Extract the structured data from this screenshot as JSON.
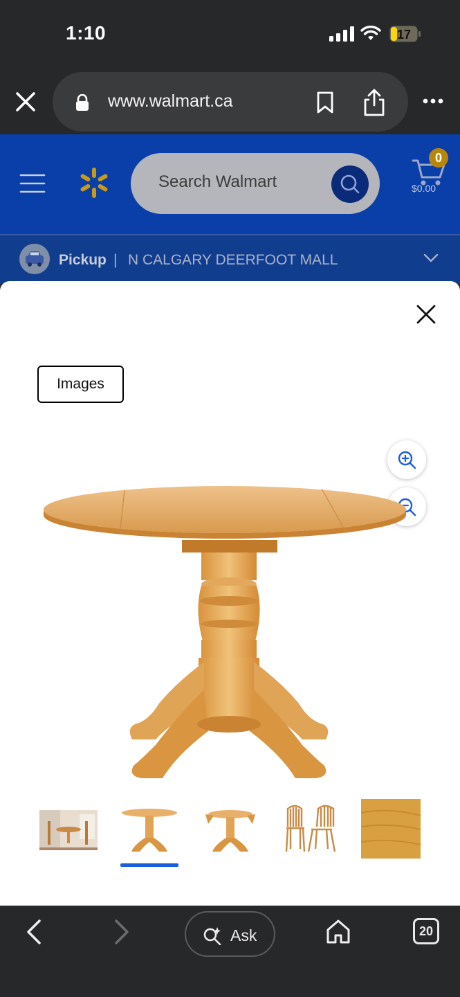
{
  "status": {
    "time": "1:10",
    "battery": "17"
  },
  "browser": {
    "url": "www.walmart.ca",
    "ask_label": "Ask",
    "tab_count": "20"
  },
  "header": {
    "search_placeholder": "Search Walmart",
    "cart_count": "0",
    "cart_total": "$0.00",
    "pickup_label": "Pickup",
    "pickup_separator": "|",
    "pickup_store": "N CALGARY DEERFOOT MALL"
  },
  "modal": {
    "tab_label": "Images",
    "thumbnails": [
      "table-and-chairs-set",
      "table-round",
      "table-dropleaf",
      "two-chairs",
      "wood-finish-swatch"
    ],
    "selected_thumbnail": 1
  },
  "colors": {
    "walmart_blue": "#0a3ea8",
    "spark_yellow": "#ffc220",
    "wood": "#e0a75a",
    "selected_indicator": "#1a5ee0"
  }
}
